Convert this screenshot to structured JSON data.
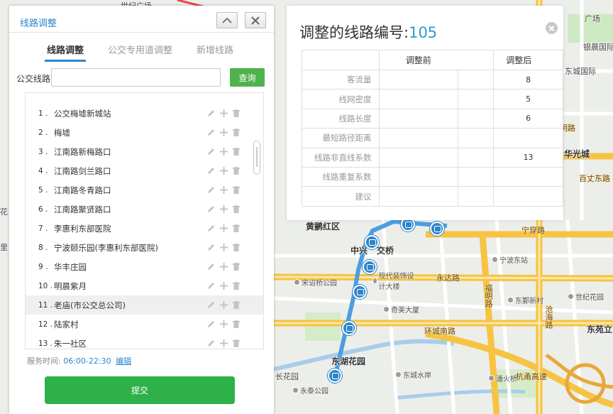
{
  "map": {
    "labels": {
      "l1": "慧明路",
      "l2": "银晨国际",
      "l3": "东城国际",
      "l4": "华光城",
      "l5": "百丈东路",
      "l6": "宁穿路",
      "l7": "宁波东站",
      "l8": "永达路",
      "l9": "东鄞新村",
      "l10": "世纪花园",
      "l11": "东苑立",
      "l12": "杭甬高速",
      "l13": "环城南路",
      "l14": "奇美大厦",
      "l15": "现代装饰设计大楼",
      "l16": "中兴",
      "l17": "交桥",
      "l18": "黄鹂红区",
      "l19": "宋诏桥公园",
      "l20": "东湖花园",
      "l21": "永泰公园",
      "l22": "东城水岸",
      "l23": "潘火桥",
      "l24": "长花园",
      "l25": "福明路",
      "l26": "沧海路",
      "l27": "广场",
      "l28": "世纪广场",
      "l29": "花",
      "l30": "里"
    }
  },
  "panel": {
    "title": "线路调整",
    "tabs": [
      "线路调整",
      "公交专用道调整",
      "新增线路"
    ],
    "search": {
      "label": "公交线路",
      "value": "",
      "placeholder": "",
      "button": "查询"
    },
    "stops": [
      {
        "num": "1 .",
        "name": "公交梅墟新城站"
      },
      {
        "num": "2 .",
        "name": "梅墟"
      },
      {
        "num": "3 .",
        "name": "江南路新梅路口"
      },
      {
        "num": "4 .",
        "name": "江南路剑兰路口"
      },
      {
        "num": "5 .",
        "name": "江南路冬青路口"
      },
      {
        "num": "6 .",
        "name": "江南路聚贤路口"
      },
      {
        "num": "7 .",
        "name": "李惠利东部医院"
      },
      {
        "num": "8 .",
        "name": "宁波颐乐园(李惠利东部医院)"
      },
      {
        "num": "9 .",
        "name": "华丰庄园"
      },
      {
        "num": "10 .",
        "name": "明晨紫月"
      },
      {
        "num": "11 .",
        "name": "老庙(市公交总公司)"
      },
      {
        "num": "12 .",
        "name": "陆家村"
      },
      {
        "num": "13 .",
        "name": "朱一社区"
      }
    ],
    "service": {
      "label": "服务时间:",
      "time": "06:00-22:30",
      "edit": "编辑"
    },
    "submit": "提交"
  },
  "popup": {
    "title_prefix": "调整的线路编号:",
    "route_number": "105",
    "col_before": "调整前",
    "col_after": "调整后",
    "rows": [
      {
        "label": "客流量",
        "before": "",
        "after": "8"
      },
      {
        "label": "线网密度",
        "before": "",
        "after": "5"
      },
      {
        "label": "线路长度",
        "before": "",
        "after": "6"
      },
      {
        "label": "最短路径距离",
        "before": "",
        "after": ""
      },
      {
        "label": "线路非直线系数",
        "before": "",
        "after": "13"
      },
      {
        "label": "线路重复系数",
        "before": "",
        "after": ""
      },
      {
        "label": "建议",
        "before": "",
        "after": ""
      }
    ]
  },
  "colors": {
    "accent": "#2e86c9",
    "submit": "#2fb14a",
    "search": "#4fb24c",
    "route": "#4a9fe0",
    "highway": "#f6c343"
  }
}
